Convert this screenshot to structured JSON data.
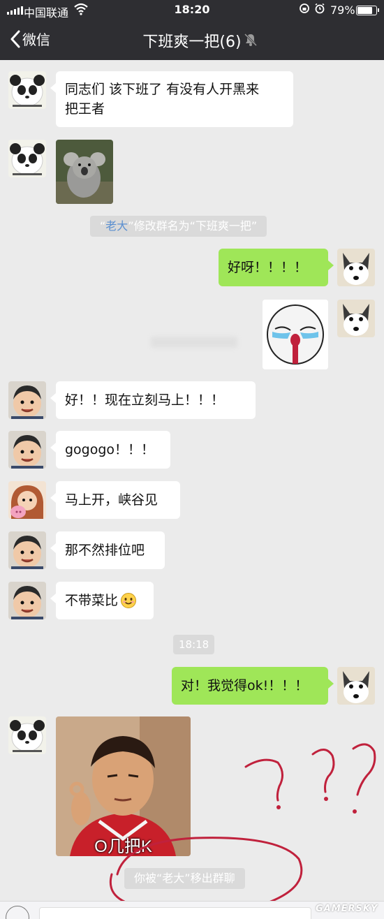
{
  "status": {
    "carrier": "中国联通",
    "time": "18:20",
    "battery": "79%",
    "battery_level": 0.79
  },
  "nav": {
    "back_label": "微信",
    "title": "下班爽一把(6)"
  },
  "messages": {
    "m1": "同志们 该下班了 有没有人开黑来\n把王者",
    "rename_q1": "“",
    "rename_name": "老大",
    "rename_rest": "”修改群名为“下班爽一把”",
    "m_out1": "好呀！！！！",
    "m3": "好！！现在立刻马上！！！",
    "m4": "gogogo！！！",
    "m5": "马上开，峡谷见",
    "m6": "那不然排位吧",
    "m7": "不带菜比",
    "time_sep": "18:18",
    "m_out2": "对！我觉得ok!！！！",
    "meme_caption": "O几把K",
    "removed": "你被“老大”移出群聊"
  },
  "watermark": "GAMERSKY",
  "colors": {
    "bar": "#2e2e32",
    "background": "#ebebeb",
    "outgoing_bubble": "#9fe658",
    "incoming_bubble": "#ffffff",
    "system_tag": "#dadada",
    "link_blue": "#5a8fd0",
    "scribble_red": "#c0213c"
  }
}
